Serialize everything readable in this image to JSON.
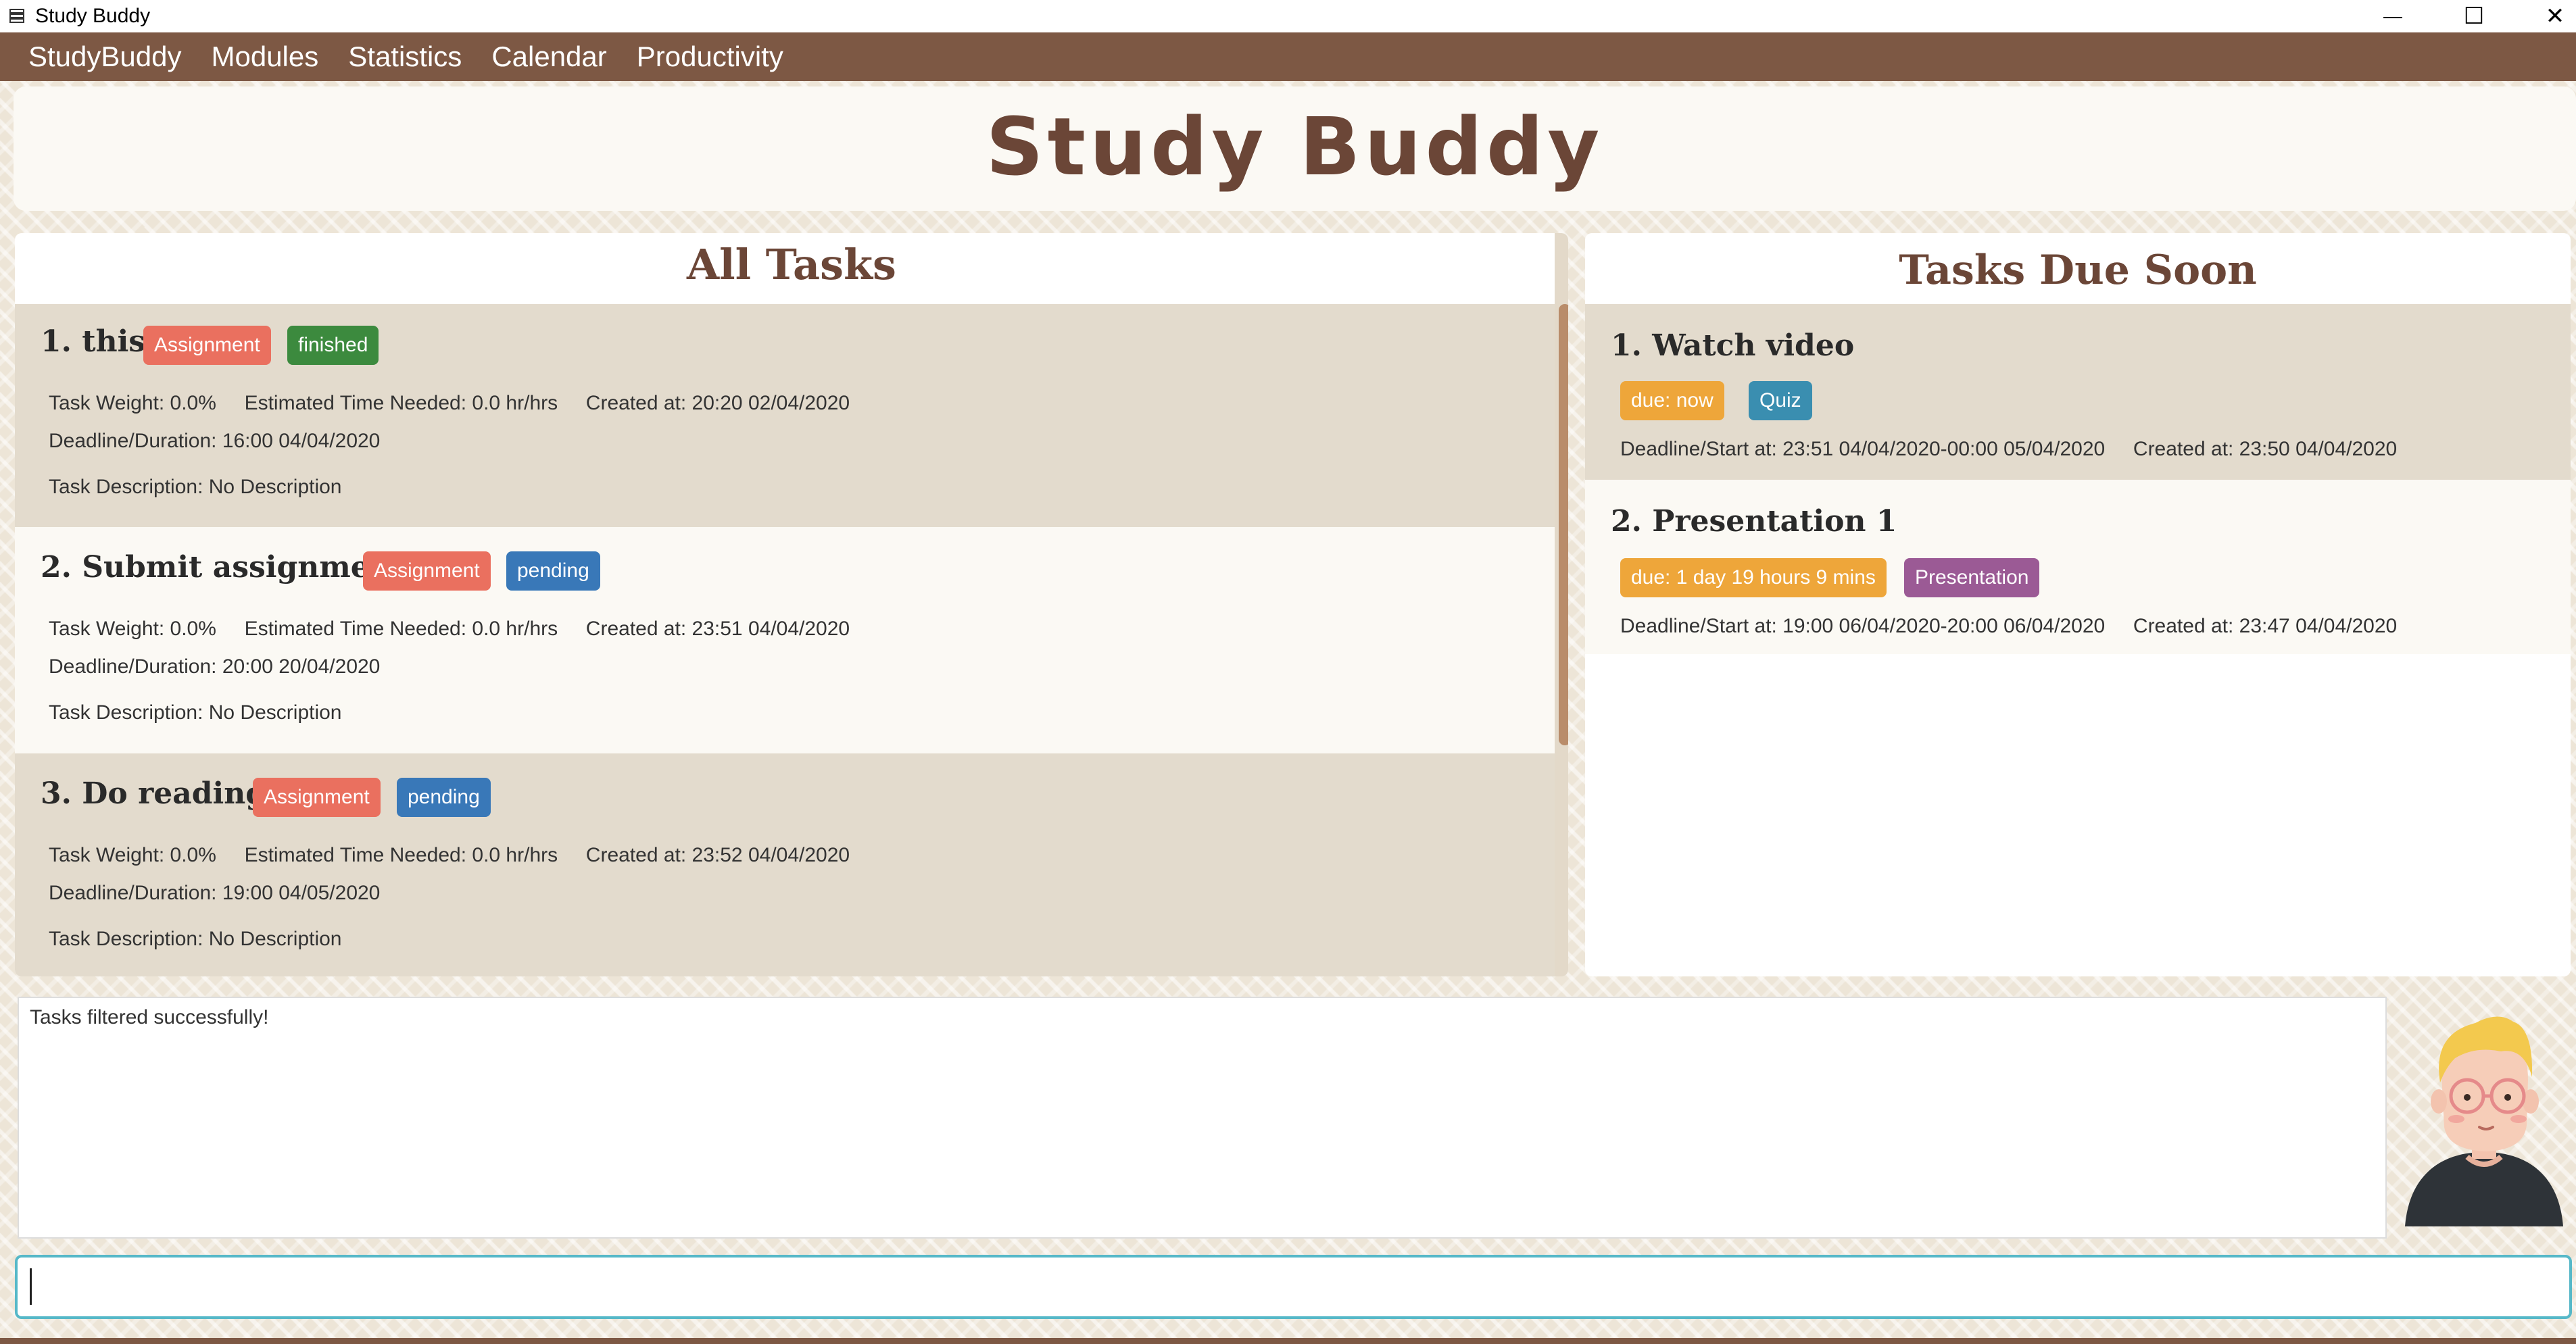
{
  "window": {
    "title": "Study Buddy",
    "icon": "book-stack-icon",
    "controls": {
      "minimize": "—",
      "maximize": "☐",
      "close": "✕"
    }
  },
  "menu": [
    "StudyBuddy",
    "Modules",
    "Statistics",
    "Calendar",
    "Productivity"
  ],
  "header": {
    "title": "Study Buddy"
  },
  "all_tasks": {
    "title": "All Tasks",
    "tasks": [
      {
        "title": "1.  this",
        "type": "Assignment",
        "status": "finished",
        "line1": "Task Weight: 0.0%     Estimated Time Needed: 0.0 hr/hrs     Created at: 20:20 02/04/2020",
        "line2": "Deadline/Duration: 16:00 04/04/2020",
        "line3": "Task Description: No Description"
      },
      {
        "title": "2.  Submit assignment",
        "type": "Assignment",
        "status": "pending",
        "line1": "Task Weight: 0.0%     Estimated Time Needed: 0.0 hr/hrs     Created at: 23:51 04/04/2020",
        "line2": "Deadline/Duration: 20:00 20/04/2020",
        "line3": "Task Description: No Description"
      },
      {
        "title": "3.  Do readings",
        "type": "Assignment",
        "status": "pending",
        "line1": "Task Weight: 0.0%     Estimated Time Needed: 0.0 hr/hrs     Created at: 23:52 04/04/2020",
        "line2": "Deadline/Duration: 19:00 04/05/2020",
        "line3": "Task Description: No Description"
      }
    ]
  },
  "due_soon": {
    "title": "Tasks Due Soon",
    "tasks": [
      {
        "title": "1.  Watch video",
        "due": "due:  now",
        "type": "Quiz",
        "line1": "Deadline/Start at: 23:51 04/04/2020-00:00 05/04/2020     Created at: 23:50 04/04/2020"
      },
      {
        "title": "2.  Presentation 1",
        "due": "due: 1 day 19 hours 9 mins",
        "type": "Presentation",
        "line1": "Deadline/Start at: 19:00 06/04/2020-20:00 06/04/2020     Created at: 23:47 04/04/2020"
      }
    ]
  },
  "result": {
    "text": "Tasks filtered successfully!"
  },
  "command": {
    "value": "",
    "placeholder": ""
  },
  "avatar": {
    "icon": "study-buddy-avatar-icon"
  }
}
